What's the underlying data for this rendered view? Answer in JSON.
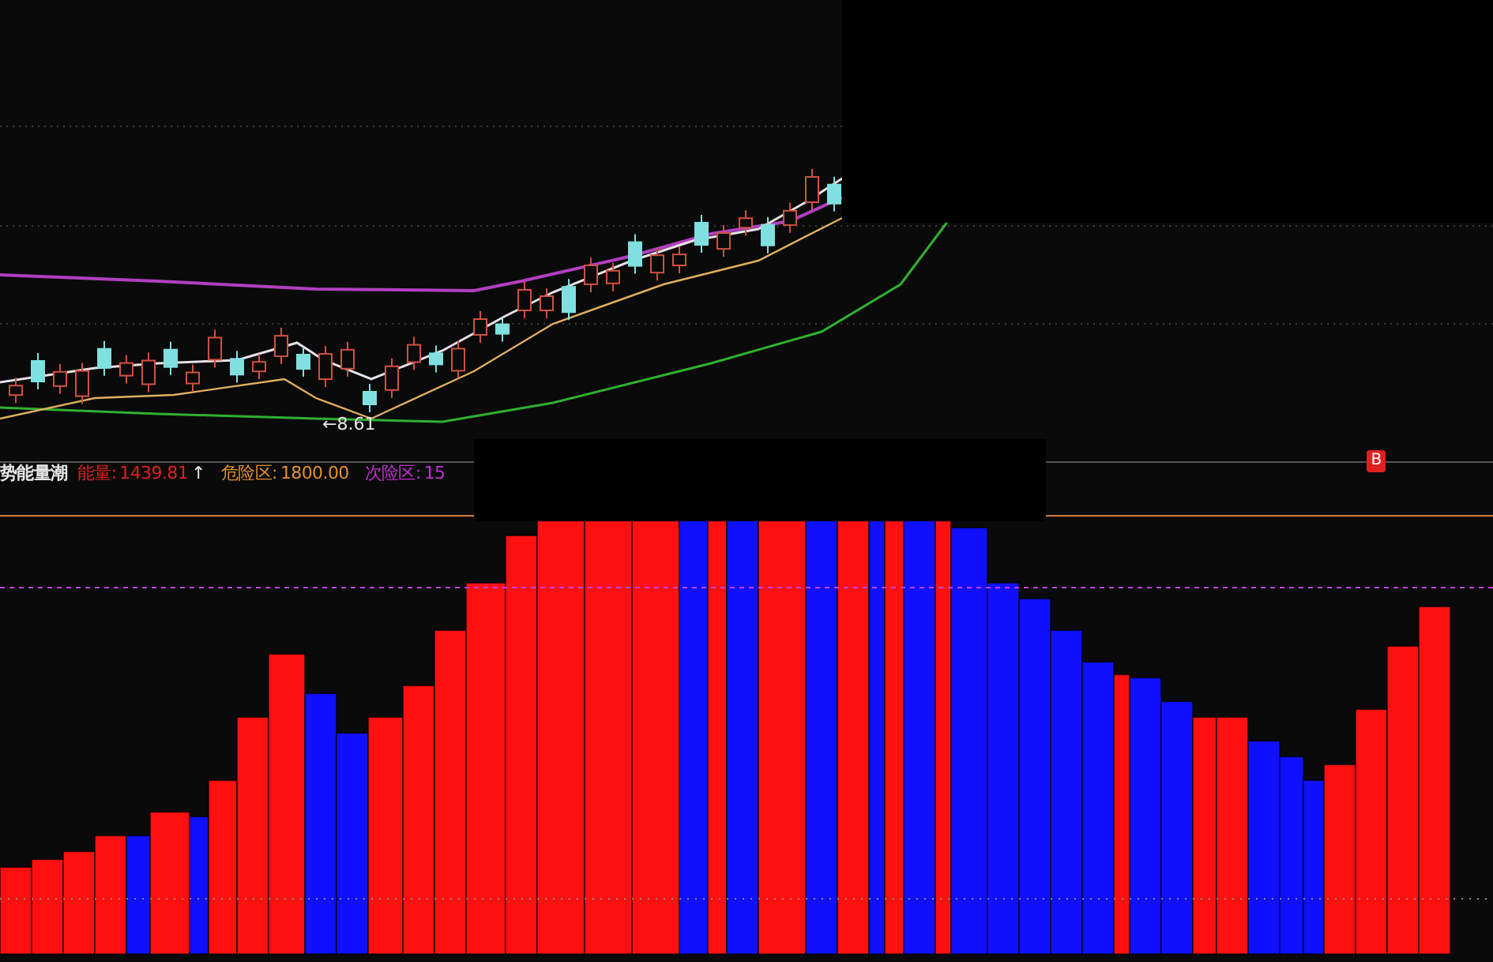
{
  "price_chart": {
    "low_label": "←8.61"
  },
  "indicator": {
    "name": "势能量潮",
    "readings": [
      {
        "label": "能量:",
        "value": "1439.81",
        "arrow": "↑",
        "color": "#e02020"
      },
      {
        "label": "危险区:",
        "value": "1800.00",
        "color": "#e09030"
      },
      {
        "label": "次险区:",
        "value": "15",
        "color": "#c030d0"
      }
    ],
    "signal_badge": "B"
  }
}
